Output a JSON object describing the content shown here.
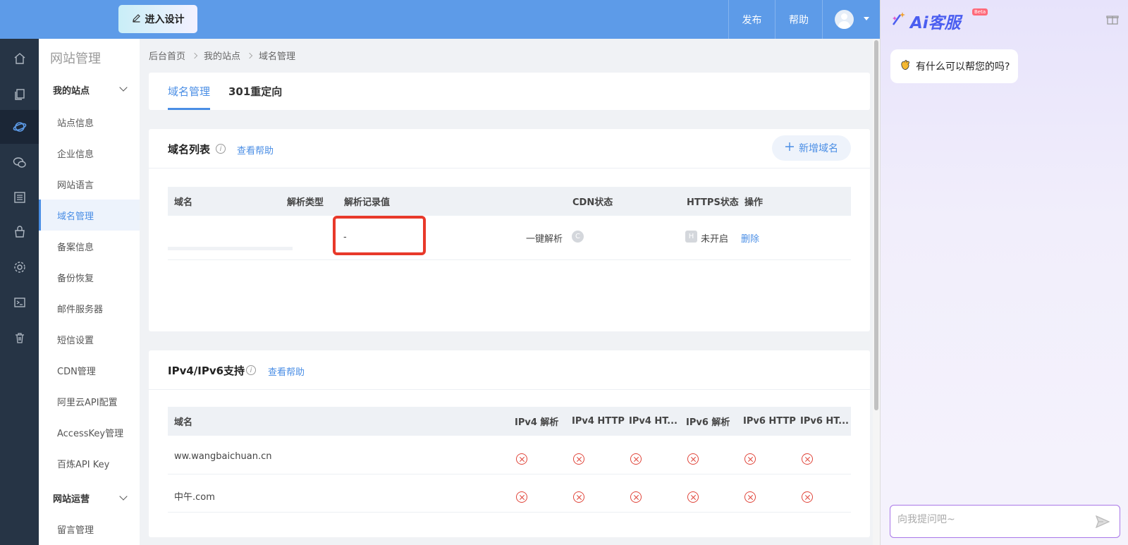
{
  "topbar": {
    "enter_design": "进入设计",
    "publish": "发布",
    "help": "帮助"
  },
  "sidebar": {
    "title": "网站管理",
    "group1": "我的站点",
    "items": [
      "站点信息",
      "企业信息",
      "网站语言",
      "域名管理",
      "备案信息",
      "备份恢复",
      "邮件服务器",
      "短信设置",
      "CDN管理",
      "阿里云API配置",
      "AccessKey管理",
      "百炼API Key"
    ],
    "group2": "网站运营",
    "items2": [
      "留言管理"
    ]
  },
  "breadcrumb": [
    "后台首页",
    "我的站点",
    "域名管理"
  ],
  "tabs": [
    "域名管理",
    "301重定向"
  ],
  "domain_list": {
    "title": "域名列表",
    "help": "查看帮助",
    "add": "新增域名",
    "headers": [
      "域名",
      "解析类型",
      "解析记录值",
      "CDN状态",
      "HTTPS状态",
      "操作"
    ],
    "row": {
      "record_value": "-",
      "one_click": "一键解析",
      "cdn_badge": "C",
      "https_badge": "H",
      "https_status": "未开启",
      "action": "删除"
    }
  },
  "ip_support": {
    "title": "IPv4/IPv6支持",
    "help": "查看帮助",
    "headers": [
      "域名",
      "IPv4 解析",
      "IPv4 HTTP",
      "IPv4 HT...",
      "IPv6 解析",
      "IPv6 HTTP",
      "IPv6 HT..."
    ],
    "rows": [
      {
        "domain": "ww.wangbaichuan.cn",
        "states": [
          "off",
          "off",
          "off",
          "off",
          "off",
          "off"
        ]
      },
      {
        "domain": "中午.com",
        "states": [
          "off",
          "off",
          "off",
          "off",
          "off",
          "off"
        ]
      }
    ]
  },
  "ai": {
    "brand": "Ai客服",
    "beta": "Beta",
    "greeting": "有什么可以帮您的吗?",
    "placeholder": "向我提问吧~"
  },
  "colors": {
    "primary": "#5d9be8",
    "link": "#4a8ee5",
    "sidebar_dark": "#263445",
    "danger": "#e0453a"
  }
}
